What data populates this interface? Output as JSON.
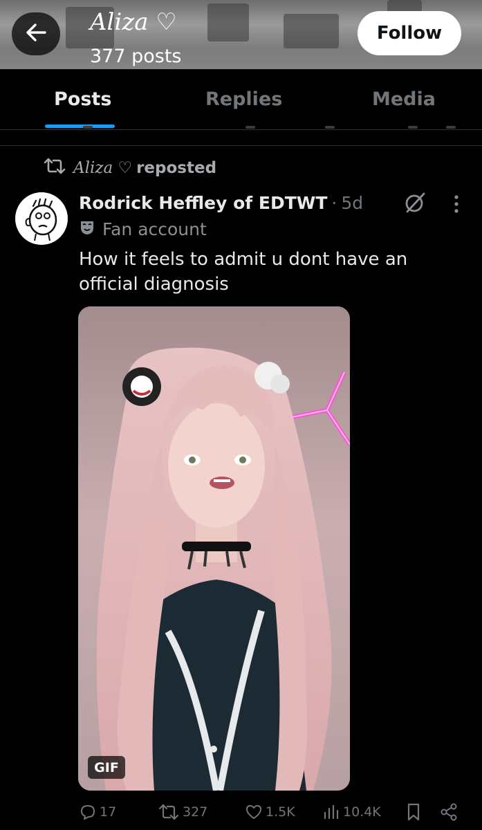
{
  "header": {
    "title": "Aliza ♡",
    "post_count": "377 posts",
    "follow_label": "Follow"
  },
  "tabs": [
    {
      "label": "Posts",
      "active": true
    },
    {
      "label": "Replies",
      "active": false
    },
    {
      "label": "Media",
      "active": false
    }
  ],
  "repost": {
    "reposter_name": "Aliza ♡",
    "reposted_label": "reposted"
  },
  "post": {
    "author": "Rodrick Heffley of EDTWT",
    "separator": "·",
    "time": "5d",
    "affiliation": "Fan account",
    "text": "How it feels to admit u dont have an official diagnosis",
    "media_badge": "GIF"
  },
  "actions": {
    "replies": "17",
    "reposts": "327",
    "likes": "1.5K",
    "views": "10.4K"
  },
  "icons": {
    "back": "back-arrow-icon",
    "repost": "repost-icon",
    "grok": "grok-icon",
    "more": "more-vertical-icon",
    "affiliation": "theater-mask-icon",
    "reply": "reply-icon",
    "like": "heart-icon",
    "views": "views-chart-icon",
    "bookmark": "bookmark-icon",
    "share": "share-icon"
  },
  "colors": {
    "background": "#000000",
    "accent": "#1d9bf0",
    "muted_text": "#71767b",
    "primary_text": "#e7e9ea"
  }
}
